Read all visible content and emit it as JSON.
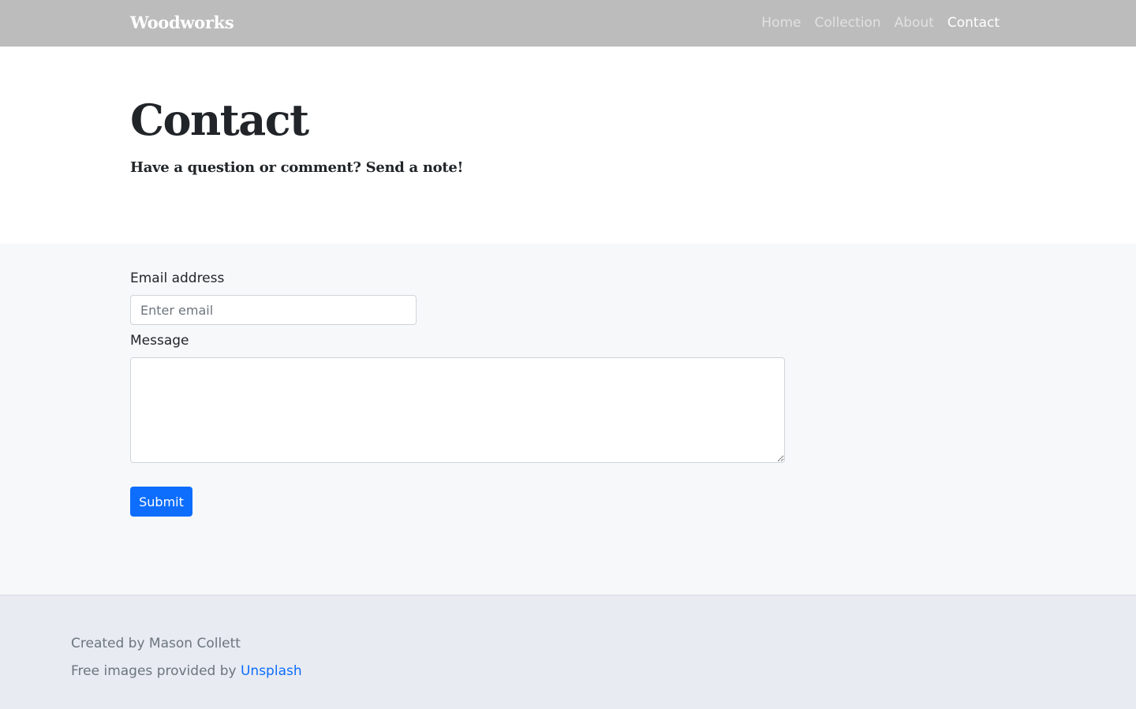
{
  "navbar": {
    "brand": "Woodworks",
    "links": [
      {
        "label": "Home",
        "active": false
      },
      {
        "label": "Collection",
        "active": false
      },
      {
        "label": "About",
        "active": false
      },
      {
        "label": "Contact",
        "active": true
      }
    ]
  },
  "hero": {
    "title": "Contact",
    "subtitle": "Have a question or comment? Send a note!"
  },
  "form": {
    "email_label": "Email address",
    "email_placeholder": "Enter email",
    "email_value": "",
    "message_label": "Message",
    "message_value": "",
    "submit_label": "Submit"
  },
  "footer": {
    "credit": "Created by Mason Collett",
    "images_prefix": "Free images provided by ",
    "images_link": "Unsplash"
  },
  "colors": {
    "navbar_bg": "#bcbcbc",
    "form_bg": "#f7f8fa",
    "footer_bg": "#e8ebf2",
    "primary": "#0d6efd"
  }
}
